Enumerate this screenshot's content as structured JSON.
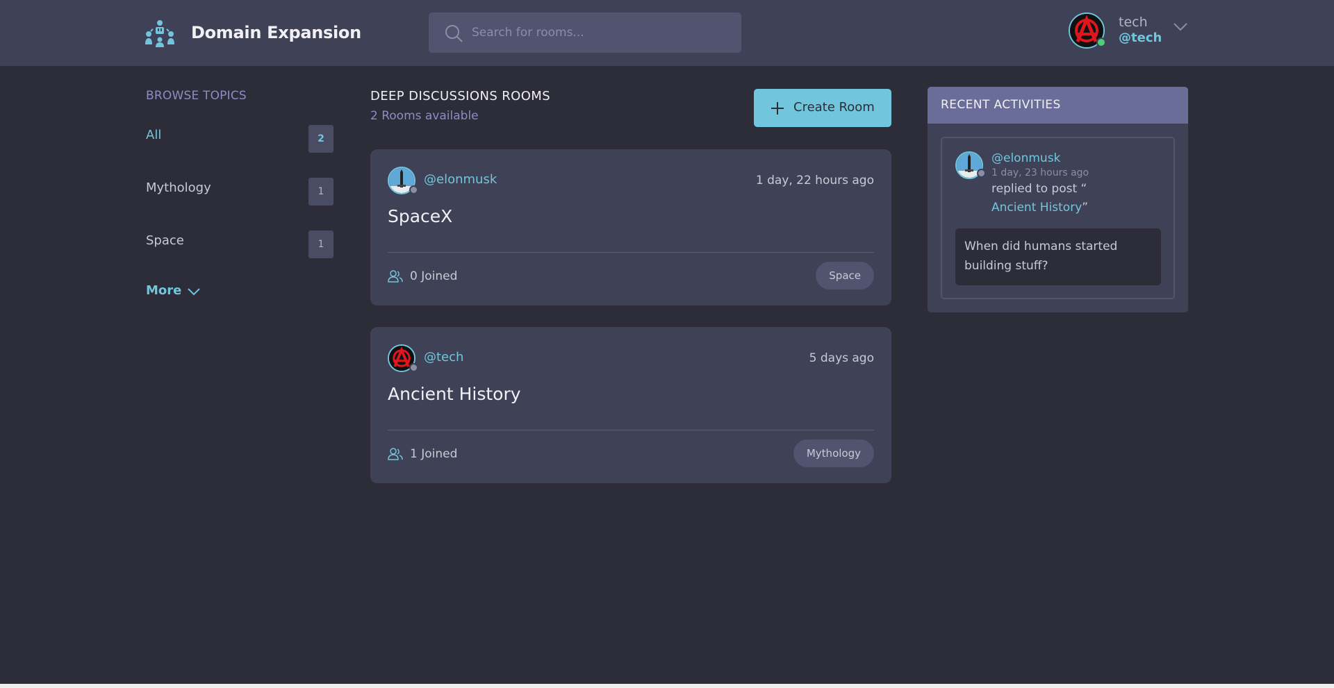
{
  "header": {
    "brand": "Domain Expansion",
    "search_placeholder": "Search for rooms...",
    "user": {
      "name": "tech",
      "handle": "@tech",
      "status_color": "#4ccf78"
    }
  },
  "sidebar": {
    "title": "BROWSE TOPICS",
    "topics": [
      {
        "label": "All",
        "count": "2",
        "active": true
      },
      {
        "label": "Mythology",
        "count": "1"
      },
      {
        "label": "Space",
        "count": "1"
      }
    ],
    "more_label": "More"
  },
  "main": {
    "title": "DEEP DISCUSSIONS ROOMS",
    "count_text": "2 Rooms available",
    "create_label": "Create Room",
    "rooms": [
      {
        "handle": "@elonmusk",
        "time": "1 day, 22 hours ago",
        "title": "SpaceX",
        "joined": "0 Joined",
        "tag": "Space",
        "avatar": "rocket"
      },
      {
        "handle": "@tech",
        "time": "5 days ago",
        "title": "Ancient History",
        "joined": "1 Joined",
        "tag": "Mythology",
        "avatar": "anarchy"
      }
    ]
  },
  "activities": {
    "title": "RECENT ACTIVITIES",
    "items": [
      {
        "handle": "@elonmusk",
        "time": "1 day, 23 hours ago",
        "text": "replied to post “",
        "link": "Ancient History",
        "link_close": "”",
        "quote": "When did humans started building stuff?"
      }
    ]
  },
  "colors": {
    "accent": "#71c6dd",
    "bg": "#2d2d39",
    "panel": "#3f4156",
    "activity_header": "#696d97"
  }
}
